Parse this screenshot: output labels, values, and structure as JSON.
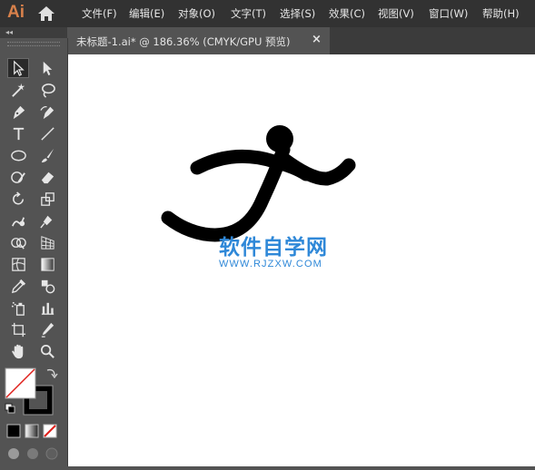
{
  "app": {
    "logo": "Ai"
  },
  "menu": [
    "文件(F)",
    "编辑(E)",
    "对象(O)",
    "文字(T)",
    "选择(S)",
    "效果(C)",
    "视图(V)",
    "窗口(W)",
    "帮助(H)"
  ],
  "document": {
    "tab_title": "未标题-1.ai* @ 186.36% (CMYK/GPU 预览)",
    "close_symbol": "×"
  },
  "watermark": {
    "main": "软件自学网",
    "url": "WWW.RJZXW.COM"
  },
  "panel": {
    "collapse_symbol": "◂◂"
  },
  "tools": [
    {
      "name": "selection-tool-icon"
    },
    {
      "name": "direct-selection-tool-icon"
    },
    {
      "name": "magic-wand-tool-icon"
    },
    {
      "name": "lasso-tool-icon"
    },
    {
      "name": "pen-tool-icon"
    },
    {
      "name": "curvature-tool-icon"
    },
    {
      "name": "type-tool-icon"
    },
    {
      "name": "line-segment-tool-icon"
    },
    {
      "name": "ellipse-tool-icon"
    },
    {
      "name": "paintbrush-tool-icon"
    },
    {
      "name": "shaper-tool-icon"
    },
    {
      "name": "eraser-tool-icon"
    },
    {
      "name": "rotate-tool-icon"
    },
    {
      "name": "scale-tool-icon"
    },
    {
      "name": "warp-tool-icon"
    },
    {
      "name": "puppet-warp-tool-icon"
    },
    {
      "name": "shape-builder-tool-icon"
    },
    {
      "name": "perspective-grid-tool-icon"
    },
    {
      "name": "mesh-tool-icon"
    },
    {
      "name": "gradient-tool-icon"
    },
    {
      "name": "eyedropper-tool-icon"
    },
    {
      "name": "blend-tool-icon"
    },
    {
      "name": "symbol-sprayer-tool-icon"
    },
    {
      "name": "column-graph-tool-icon"
    },
    {
      "name": "artboard-tool-icon"
    },
    {
      "name": "slice-tool-icon"
    },
    {
      "name": "hand-tool-icon"
    },
    {
      "name": "zoom-tool-icon"
    }
  ],
  "colors": {
    "accent": "#d8814b",
    "watermark": "#2f88d8",
    "menubar": "#323232",
    "panel": "#535353",
    "canvas": "#ffffff",
    "stroke": "#000000"
  }
}
